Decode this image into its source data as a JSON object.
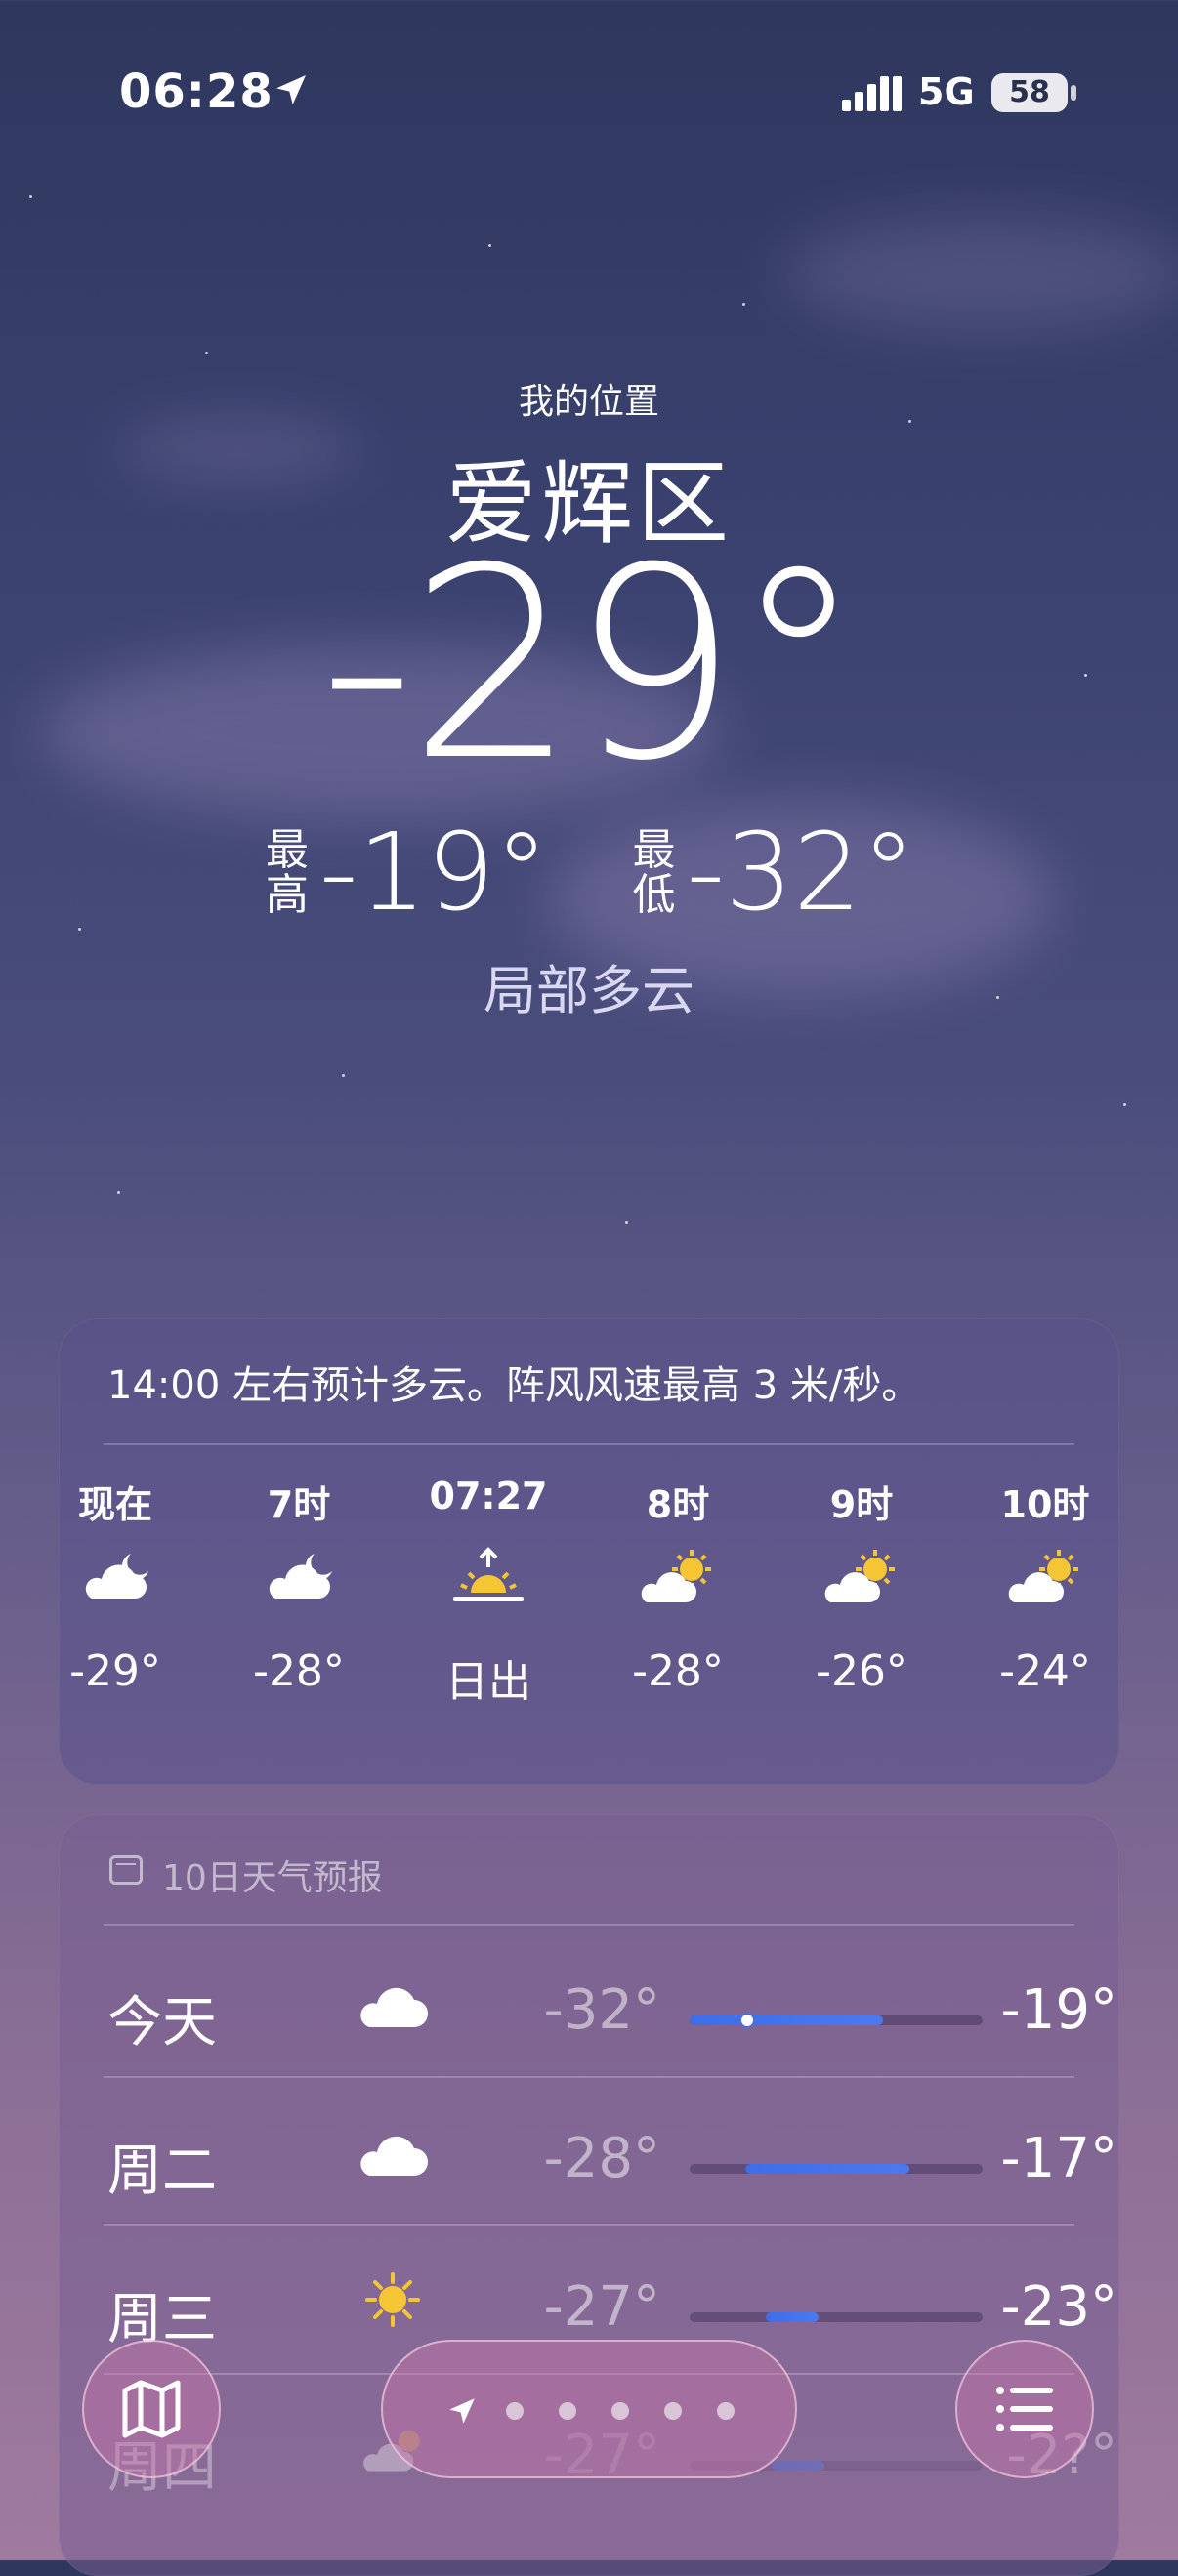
{
  "status": {
    "time": "06:28",
    "network": "5G",
    "battery": "58"
  },
  "header": {
    "my_location": "我的位置",
    "city": "爱辉区",
    "temperature": "-29°",
    "high_label": "最\n高",
    "high": "-19°",
    "low_label": "最\n低",
    "low": "-32°",
    "condition": "局部多云"
  },
  "hourly": {
    "summary": "14:00 左右预计多云。阵风风速最高 3 米/秒。",
    "items": [
      {
        "label": "现在",
        "icon": "cloud-moon-icon",
        "temp": "-29°"
      },
      {
        "label": "7时",
        "icon": "cloud-moon-icon",
        "temp": "-28°"
      },
      {
        "label": "07:27",
        "icon": "sunrise-icon",
        "temp": "日出"
      },
      {
        "label": "8时",
        "icon": "cloud-sun-icon",
        "temp": "-28°"
      },
      {
        "label": "9时",
        "icon": "cloud-sun-icon",
        "temp": "-26°"
      },
      {
        "label": "10时",
        "icon": "cloud-sun-icon",
        "temp": "-24°"
      }
    ]
  },
  "daily": {
    "title": "10日天气预报",
    "rows": [
      {
        "day": "今天",
        "icon": "cloud-icon",
        "low": "-32°",
        "high": "-19°",
        "bar_start": 0.0,
        "bar_end": 0.66,
        "current_marker": 0.18
      },
      {
        "day": "周二",
        "icon": "cloud-icon",
        "low": "-28°",
        "high": "-17°",
        "bar_start": 0.19,
        "bar_end": 0.75
      },
      {
        "day": "周三",
        "icon": "sun-icon",
        "low": "-27°",
        "high": "-23°",
        "bar_start": 0.26,
        "bar_end": 0.44
      },
      {
        "day": "周四",
        "icon": "cloud-sun-icon",
        "low": "-27°",
        "high": "-2?°",
        "bar_start": 0.28,
        "bar_end": 0.46
      }
    ]
  },
  "toolbar": {
    "map_icon": "map-icon",
    "list_icon": "list-icon",
    "location_icon": "location-arrow-icon",
    "page_dots": 5
  },
  "colors": {
    "accent_blue": "#3d6ee8",
    "sun_yellow": "#f6c533"
  }
}
